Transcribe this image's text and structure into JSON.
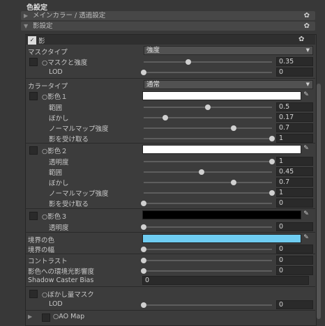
{
  "title": "色設定",
  "foldout1": {
    "label": "メインカラー / 透過設定",
    "arrow": "▶"
  },
  "foldout2": {
    "label": "影設定",
    "arrow": "▼"
  },
  "header": {
    "check": "✓",
    "label": "影"
  },
  "mask_type": {
    "label": "マスクタイプ",
    "value": "強度"
  },
  "mask_strength": {
    "label": "○マスクと強度",
    "value": "0.35",
    "level": 0.35
  },
  "lod1": {
    "label": "LOD",
    "value": "0",
    "level": 0
  },
  "color_type": {
    "label": "カラータイプ",
    "value": "通常"
  },
  "shadow1": {
    "label": "○影色１",
    "color": "#ffffff"
  },
  "range1": {
    "label": "範囲",
    "value": "0.5",
    "level": 0.5
  },
  "blur1": {
    "label": "ぼかし",
    "value": "0.17",
    "level": 0.17
  },
  "normal1": {
    "label": "ノーマルマップ強度",
    "value": "0.7",
    "level": 0.7
  },
  "recv1": {
    "label": "影を受け取る",
    "value": "1",
    "level": 1
  },
  "shadow2": {
    "label": "○影色２",
    "color": "#ffffff"
  },
  "alpha2": {
    "label": "透明度",
    "value": "1",
    "level": 1
  },
  "range2": {
    "label": "範囲",
    "value": "0.45",
    "level": 0.45
  },
  "blur2": {
    "label": "ぼかし",
    "value": "0.7",
    "level": 0.7
  },
  "normal2": {
    "label": "ノーマルマップ強度",
    "value": "1",
    "level": 1
  },
  "recv2": {
    "label": "影を受け取る",
    "value": "0",
    "level": 0
  },
  "shadow3": {
    "label": "○影色３",
    "color": "#000000"
  },
  "alpha3": {
    "label": "透明度",
    "value": "0",
    "level": 0
  },
  "border_color": {
    "label": "境界の色",
    "color": "#6fcdf2"
  },
  "border_width": {
    "label": "境界の幅",
    "value": "0",
    "level": 0
  },
  "contrast": {
    "label": "コントラスト",
    "value": "0",
    "level": 0
  },
  "env": {
    "label": "影色への環境光影響度",
    "value": "0",
    "level": 0
  },
  "caster_bias": {
    "label": "Shadow Caster Bias",
    "value": "0"
  },
  "blur_mask": {
    "label": "○ぼかし量マスク"
  },
  "lod2": {
    "label": "LOD",
    "value": "0",
    "level": 0
  },
  "ao_map": {
    "label": "○AO Map",
    "arrow": "▶"
  },
  "gear": "✿",
  "picker": "✎"
}
